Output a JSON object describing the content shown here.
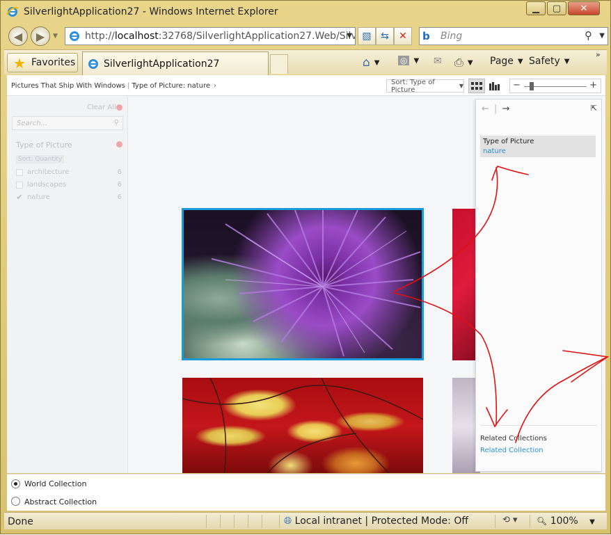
{
  "window": {
    "title": "SilverlightApplication27 - Windows Internet Explorer"
  },
  "nav": {
    "url_prefix": "http://",
    "url_host": "localhost",
    "url_rest": ":32768/SilverlightApplication27.Web/Silverli",
    "search_placeholder": "Bing"
  },
  "favbar": {
    "favorites_label": "Favorites",
    "tab_title": "SilverlightApplication27",
    "page_label": "Page",
    "safety_label": "Safety"
  },
  "pivot": {
    "breadcrumb_collection": "Pictures That Ship With Windows",
    "breadcrumb_filter": "Type of Picture: nature",
    "sort_label": "Sort: Type of Picture"
  },
  "filter": {
    "clear_all": "Clear All",
    "search_placeholder": "Search...",
    "facet_title": "Type of Picture",
    "facet_sort": "Sort: Quantity",
    "items": [
      {
        "label": "architecture",
        "count": "6",
        "checked": false
      },
      {
        "label": "landscapes",
        "count": "6",
        "checked": false
      },
      {
        "label": "nature",
        "count": "6",
        "checked": true
      }
    ]
  },
  "info_panel": {
    "facet_name": "Type of Picture",
    "facet_value": "nature",
    "related_title": "Related Collections",
    "related_link": "Related Collection"
  },
  "options": {
    "world": "World Collection",
    "abstract": "Abstract Collection",
    "selected": "World Collection"
  },
  "status": {
    "done": "Done",
    "zone": "Local intranet | Protected Mode: Off",
    "zoom": "100%"
  },
  "colors": {
    "selection_border": "#1a9ad8",
    "link": "#2a8fd0",
    "annotation": "#e01010"
  }
}
